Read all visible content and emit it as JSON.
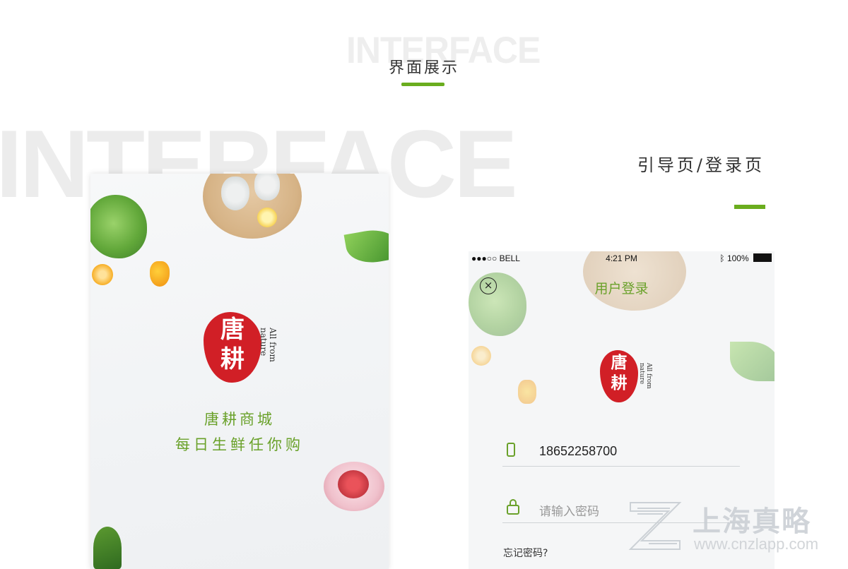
{
  "header": {
    "bg_word": "INTERFACE",
    "title": "界面展示"
  },
  "background": {
    "big_word": "INTERFACE"
  },
  "section": {
    "title": "引导页/登录页"
  },
  "splash": {
    "logo_chars": [
      "唐",
      "耕"
    ],
    "logo_tagline": "All from nature",
    "name": "唐耕商城",
    "slogan": "每日生鲜任你购"
  },
  "login": {
    "status_bar": {
      "carrier": "●●●○○ BELL",
      "time": "4:21 PM",
      "battery": "100%"
    },
    "close_icon": "×",
    "title": "用户登录",
    "logo_chars": [
      "唐",
      "耕"
    ],
    "logo_tagline": "All from nature",
    "phone_field": {
      "value": "18652258700"
    },
    "password_field": {
      "placeholder": "请输入密码"
    },
    "forgot_link": "忘记密码?"
  },
  "watermark": {
    "brand": "上海真略",
    "url": "www.cnzlapp.com"
  },
  "colors": {
    "accent": "#6aad1e",
    "seal_red": "#d11f26"
  }
}
